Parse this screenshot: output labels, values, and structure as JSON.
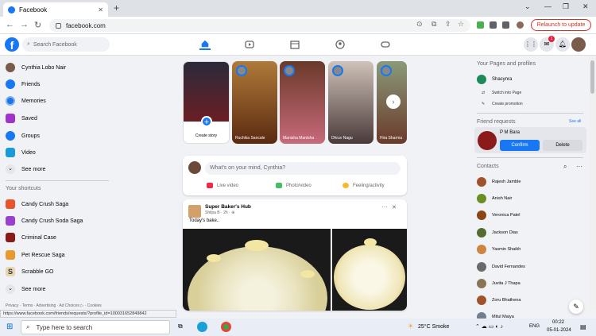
{
  "browser": {
    "tab_title": "Facebook",
    "url": "facebook.com",
    "relaunch_label": "Relaunch to update",
    "new_tab": "+",
    "close_tab": "✕",
    "window_controls": [
      "⌄",
      "—",
      "❐",
      "✕"
    ]
  },
  "fb": {
    "search_placeholder": "Search Facebook",
    "messenger_badge": "1"
  },
  "left_nav": {
    "user": "Cynthia Lobo Nair",
    "items": [
      "Friends",
      "Memories",
      "Saved",
      "Groups",
      "Video",
      "See more"
    ],
    "shortcuts_heading": "Your shortcuts",
    "shortcuts": [
      "Candy Crush Saga",
      "Candy Crush Soda Saga",
      "Criminal Case",
      "Pet Rescue Saga",
      "Scrabble GO",
      "See more"
    ],
    "footer": "Privacy · Terms · Advertising · Ad Choices ▷ · Cookies"
  },
  "stories": {
    "create_label": "Create story",
    "items": [
      {
        "name": "Ruchika Sancale",
        "color": "#8a5a2a"
      },
      {
        "name": "Manisha Manisha",
        "color": "#6a4a3a"
      },
      {
        "name": "Dhruv Nagu",
        "color": "#7a6a6a"
      },
      {
        "name": "Hira Sharma",
        "color": "#4a6a7a"
      }
    ]
  },
  "composer": {
    "placeholder": "What's on your mind, Cynthia?",
    "live": "Live video",
    "photo": "Photo/video",
    "feeling": "Feeling/activity"
  },
  "post": {
    "author": "Super Baker's Hub",
    "meta": "Shilpa B · 2h · ⊕",
    "text": "Today's bake..",
    "more": "···",
    "close": "✕"
  },
  "right_panel": {
    "pages_heading": "Your Pages and profiles",
    "page_name": "Shacynra",
    "switch": "Switch into Page",
    "promotion": "Create promotion",
    "requests_heading": "Friend requests",
    "see_all": "See all",
    "request_name": "P M Bara",
    "confirm": "Confirm",
    "delete": "Delete",
    "contacts_heading": "Contacts",
    "contacts": [
      "Rajesh Jamble",
      "Anish Nair",
      "Veronica Patel",
      "Jackson Dias",
      "Yasmin Shaikh",
      "David Fernandes",
      "Juvita J Thapa",
      "Zoru Bhathena",
      "Mitul Maiya"
    ],
    "contact_colors": [
      "#a0522d",
      "#6b8e23",
      "#8b4513",
      "#556b2f",
      "#cd853f",
      "#696969",
      "#8b7355",
      "#a0522d",
      "#708090"
    ]
  },
  "status_url": "https://www.facebook.com/friends/requests/?profile_id=100031652849842",
  "taskbar": {
    "search": "Type here to search",
    "weather": "25°C  Smoke",
    "lang": "ENG",
    "time": "00:22",
    "date": "05-01-2024"
  }
}
